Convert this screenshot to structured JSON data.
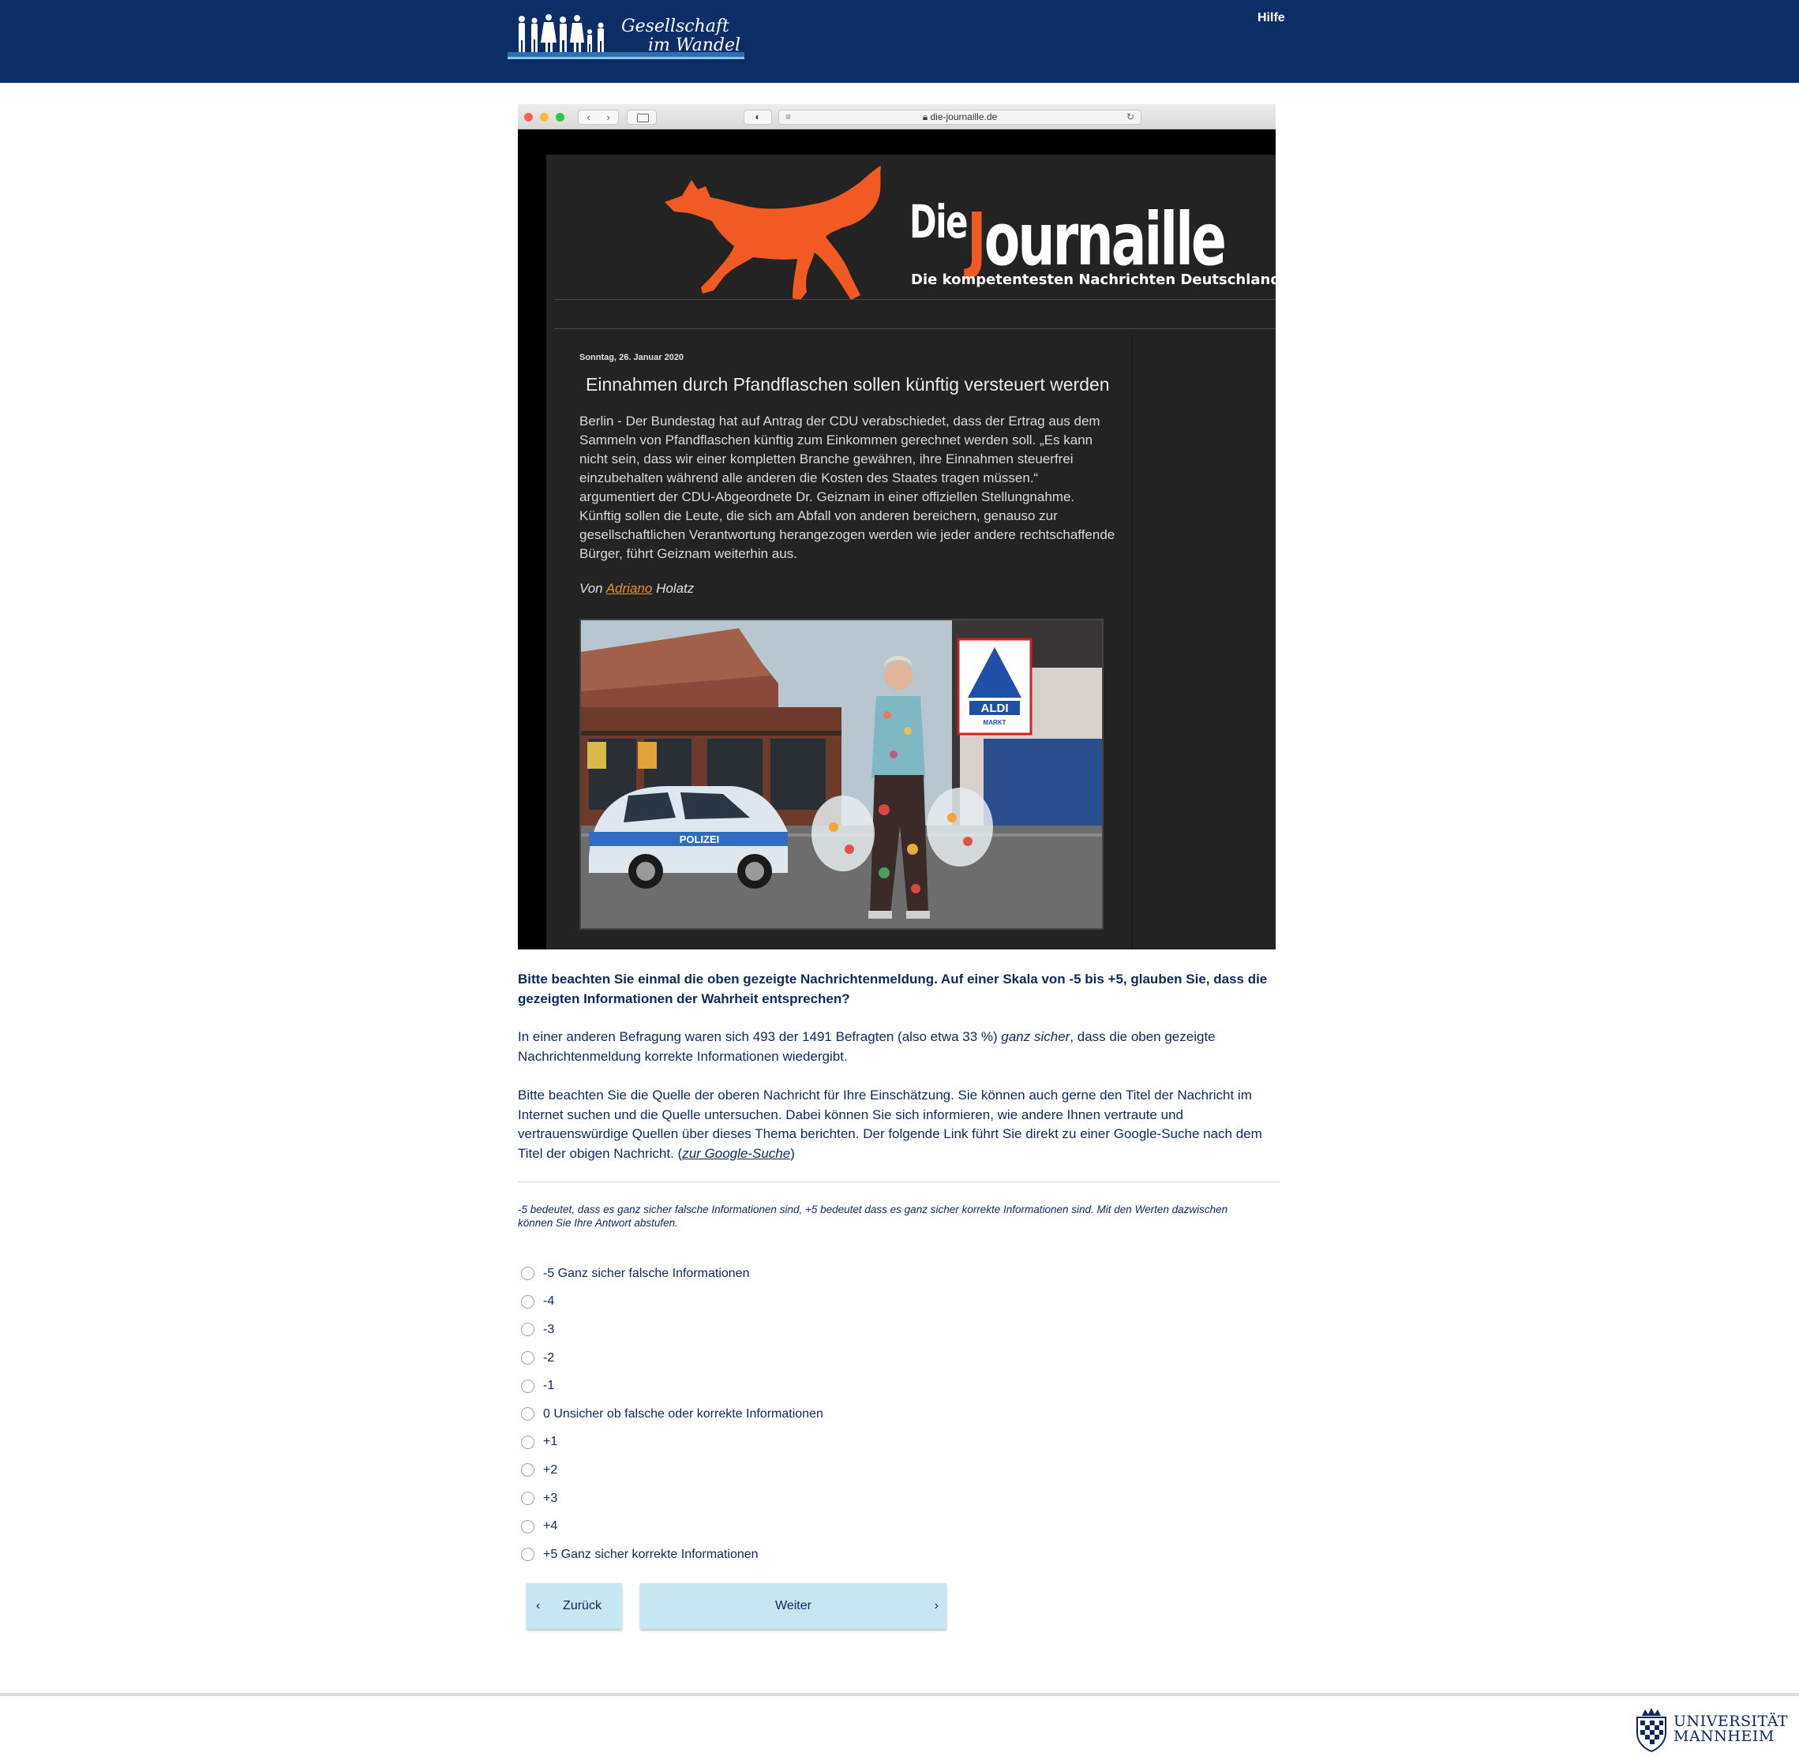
{
  "header": {
    "logo_text_line1": "Gesellschaft",
    "logo_text_line2": "im Wandel",
    "help_label": "Hilfe"
  },
  "browser": {
    "url": "die-journaille.de",
    "site": {
      "brand_die": "Die",
      "brand_j": "J",
      "brand_rest": "ournaille",
      "tagline": "Die kompetentesten Nachrichten Deutschlands",
      "post_date": "Sonntag, 26. Januar 2020",
      "post_title": "Einnahmen durch Pfandflaschen sollen künftig versteuert werden",
      "post_body": "Berlin - Der Bundestag hat auf Antrag der CDU verabschiedet, dass der Ertrag aus dem Sammeln von Pfandflaschen künftig zum Einkommen gerechnet werden soll. „Es kann nicht sein, dass wir einer kompletten Branche gewähren, ihre Einnahmen steuerfrei einzubehalten während alle anderen die Kosten des Staates tragen müssen.“ argumentiert der CDU-Abgeordnete Dr. Geiznam in einer offiziellen Stellungnahme. Künftig sollen die Leute, die sich am Abfall von anderen bereichern, genauso zur gesellschaftlichen Verantwortung herangezogen werden wie jeder andere rechtschaffende Bürger, führt Geiznam weiterhin aus.",
      "author_prefix": "Von",
      "author_first": "Adriano",
      "author_last": "Holatz",
      "photo_sign_store": "ALDI",
      "photo_sign_sub": "MARKT",
      "photo_car_text": "POLIZEI"
    }
  },
  "survey": {
    "question": "Bitte beachten Sie einmal die oben gezeigte Nachrichtenmeldung. Auf einer Skala von -5 bis +5, glauben Sie, dass die gezeigten Informationen der Wahrheit entsprechen?",
    "para1_before": "In einer anderen Befragung waren sich 493 der 1491 Befragten (also etwa 33 %) ",
    "para1_emph": "ganz sicher",
    "para1_after": ", dass die oben gezeigte Nachrichtenmeldung korrekte Informationen wiedergibt.",
    "para2_before": "Bitte beachten Sie die Quelle der oberen Nachricht für Ihre Einschätzung. Sie können auch gerne den Titel der Nachricht im Internet suchen und die Quelle untersuchen. Dabei können Sie sich informieren, wie andere Ihnen vertraute und vertrauenswürdige Quellen über dieses Thema berichten. Der folgende Link führt Sie direkt zu einer Google-Suche nach dem Titel der obigen Nachricht. (",
    "para2_link": "zur Google-Suche",
    "para2_after": ")",
    "hint": "-5 bedeutet, dass es ganz sicher falsche Informationen sind, +5 bedeutet dass es ganz sicher korrekte Informationen sind. Mit den Werten dazwischen können Sie Ihre Antwort abstufen.",
    "options": [
      "-5 Ganz sicher falsche Informationen",
      "-4",
      "-3",
      "-2",
      "-1",
      "0 Unsicher ob falsche oder korrekte Informationen",
      "+1",
      "+2",
      "+3",
      "+4",
      "+5 Ganz sicher korrekte Informationen"
    ],
    "back_label": "Zurück",
    "next_label": "Weiter"
  },
  "footer": {
    "uni_line1": "UNIVERSITÄT",
    "uni_line2": "MANNHEIM"
  },
  "colors": {
    "header_bg": "#0b2e66",
    "text": "#0d2a5c",
    "button_bg": "#c6e6f2",
    "brand_accent": "#f15a22"
  }
}
